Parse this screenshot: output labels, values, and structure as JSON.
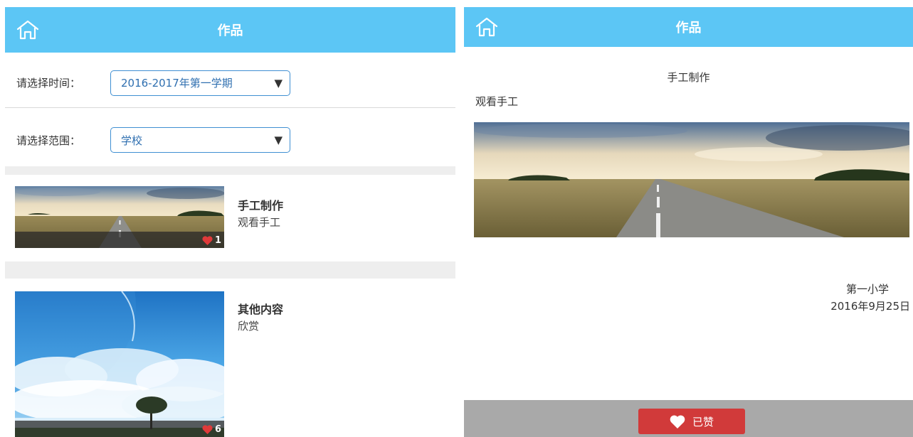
{
  "left": {
    "header": {
      "title": "作品"
    },
    "filters": {
      "time": {
        "label": "请选择时间：",
        "value": "2016-2017年第一学期"
      },
      "scope": {
        "label": "请选择范围：",
        "value": "学校"
      }
    },
    "items": [
      {
        "title": "手工制作",
        "subtitle": "观看手工",
        "likes": "1",
        "image": "road-landscape"
      },
      {
        "title": "其他内容",
        "subtitle": "欣赏",
        "likes": "6",
        "image": "sky-clouds-tree"
      }
    ]
  },
  "right": {
    "header": {
      "title": "作品"
    },
    "detail": {
      "title": "手工制作",
      "description": "观看手工",
      "image": "road-landscape",
      "school": "第一小学",
      "date": "2016年9月25日"
    },
    "footer": {
      "liked_label": "已赞"
    }
  },
  "colors": {
    "header": "#5cc6f5",
    "select_border": "#3f8fd2",
    "liked_button": "#d13a3a",
    "heart": "#e03a3a"
  }
}
